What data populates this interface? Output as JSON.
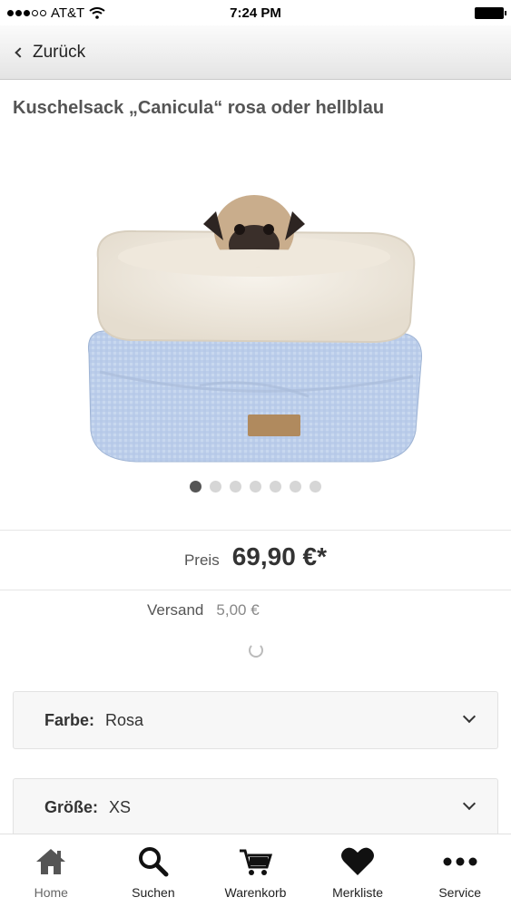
{
  "status_bar": {
    "carrier": "AT&T",
    "time": "7:24 PM"
  },
  "nav": {
    "back_label": "Zurück"
  },
  "product": {
    "title": "Kuschelsack „Canicula“ rosa oder hellblau",
    "image_count": 7,
    "active_image": 1
  },
  "pricing": {
    "price_label": "Preis",
    "price_value": "69,90 €*",
    "shipping_label": "Versand",
    "shipping_value": "5,00 €"
  },
  "options": [
    {
      "label": "Farbe:",
      "value": "Rosa"
    },
    {
      "label": "Größe:",
      "value": "XS"
    }
  ],
  "tabs": [
    {
      "label": "Home",
      "icon": "home-icon"
    },
    {
      "label": "Suchen",
      "icon": "search-icon"
    },
    {
      "label": "Warenkorb",
      "icon": "cart-icon"
    },
    {
      "label": "Merkliste",
      "icon": "heart-icon"
    },
    {
      "label": "Service",
      "icon": "more-icon"
    }
  ],
  "colors": {
    "accent": "#333333",
    "nav_bg": "#ececec",
    "bed_blue": "#bcd0ea",
    "fleece": "#f2ede3"
  }
}
